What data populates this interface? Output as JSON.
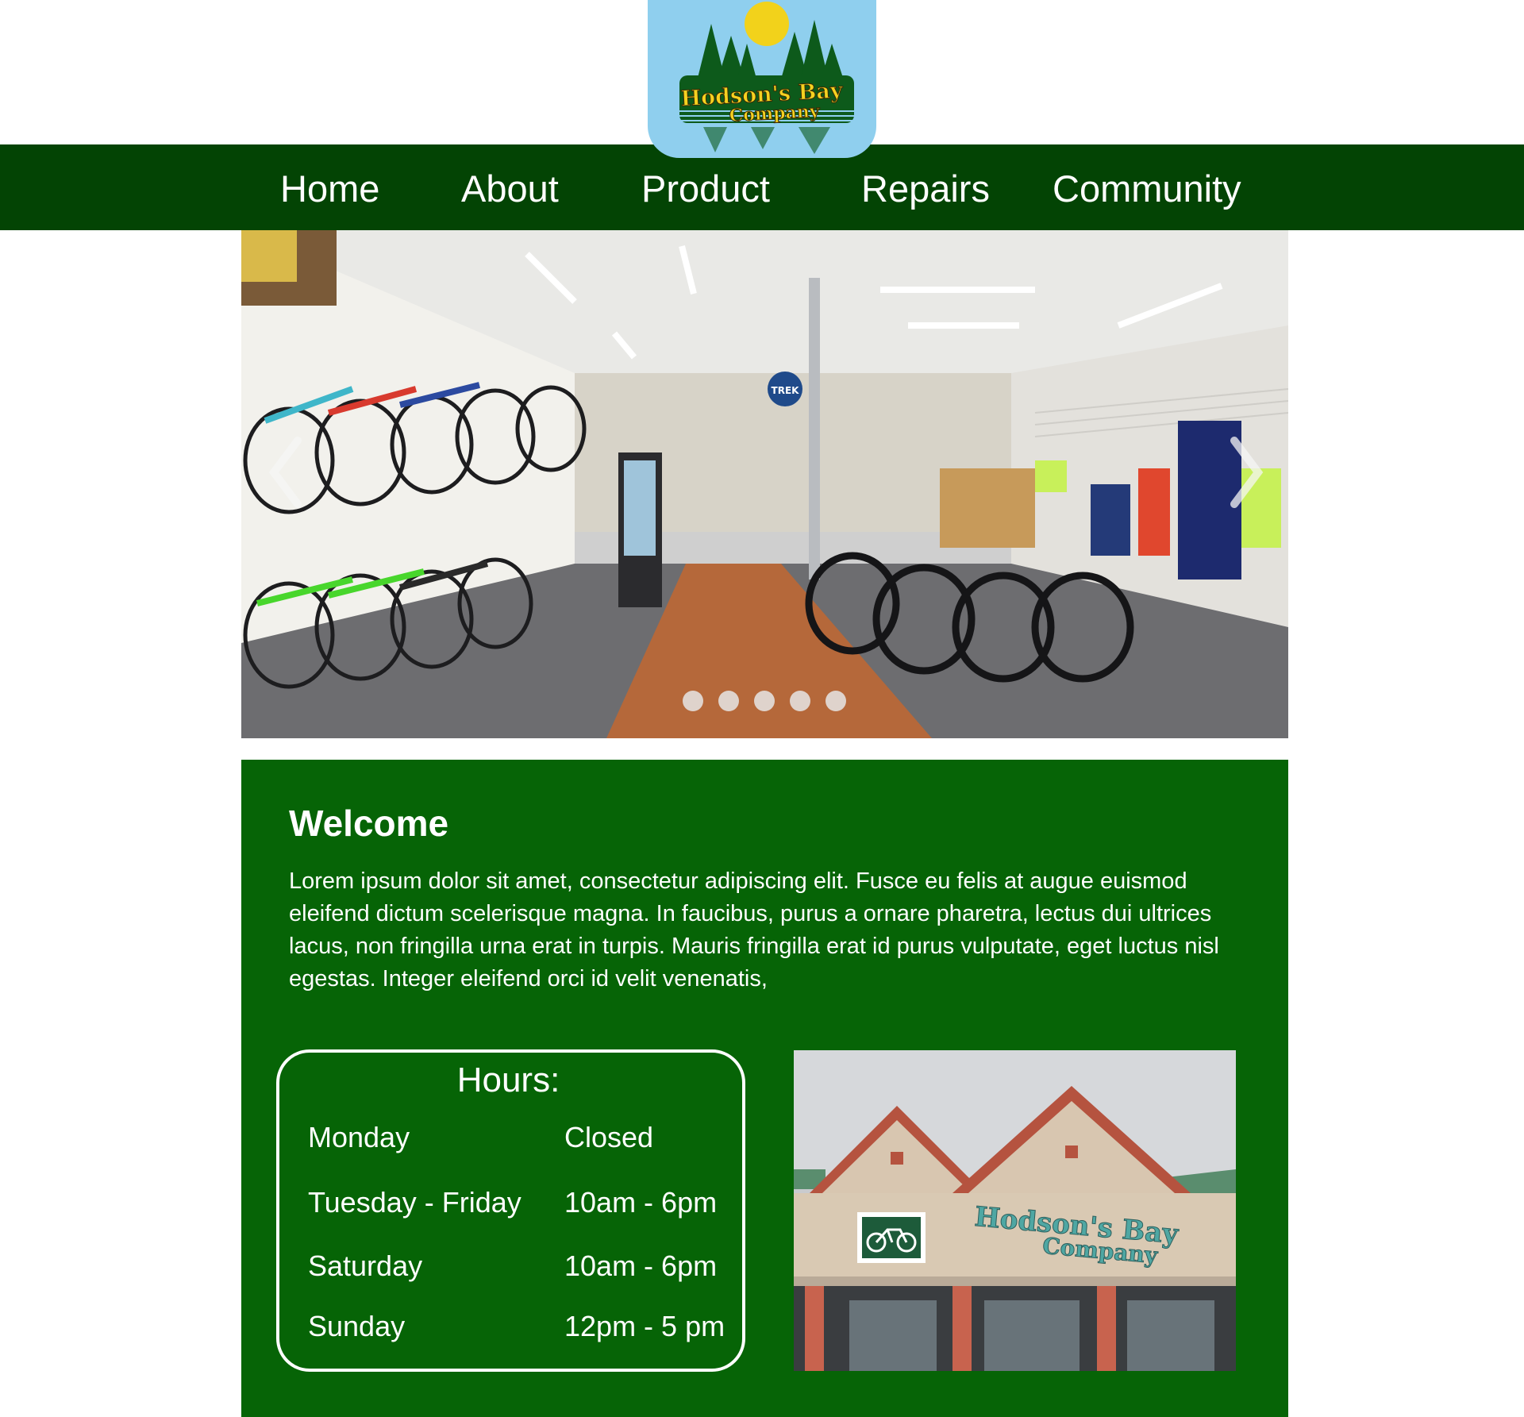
{
  "brand": {
    "logo_text_line1": "Hodson's Bay",
    "logo_text_line2": "Company"
  },
  "nav": {
    "items": [
      {
        "label": "Home"
      },
      {
        "label": "About"
      },
      {
        "label": "Product"
      },
      {
        "label": "Repairs"
      },
      {
        "label": "Community"
      }
    ]
  },
  "hero": {
    "image": "bike-shop-interior-photo",
    "prev_icon": "chevron-left-icon",
    "next_icon": "chevron-right-icon",
    "slide_count": 5,
    "sign_text": "TREK"
  },
  "welcome": {
    "title": "Welcome",
    "body": "Lorem ipsum dolor sit amet, consectetur adipiscing elit. Fusce eu felis at augue euismod eleifend dictum scelerisque magna. In faucibus, purus a ornare pharetra, lectus dui ultrices lacus, non fringilla urna erat in turpis. Mauris fringilla erat id purus vulputate, eget luctus nisl egestas. Integer eleifend orci id velit venenatis,"
  },
  "hours": {
    "title": "Hours:",
    "rows": [
      {
        "day": "Monday",
        "time": "Closed"
      },
      {
        "day": "Tuesday - Friday",
        "time": "10am - 6pm"
      },
      {
        "day": "Saturday",
        "time": "10am - 6pm"
      },
      {
        "day": "Sunday",
        "time": "12pm - 5 pm"
      }
    ]
  },
  "storefront": {
    "image": "storefront-photo",
    "sign_line1": "Hodson's Bay",
    "sign_line2": "Company",
    "sign_icon": "bicycle-icon"
  },
  "colors": {
    "nav_bg": "#034404",
    "panel_bg": "#066406",
    "logo_bg": "#8fcfee",
    "text": "#ffffff"
  }
}
